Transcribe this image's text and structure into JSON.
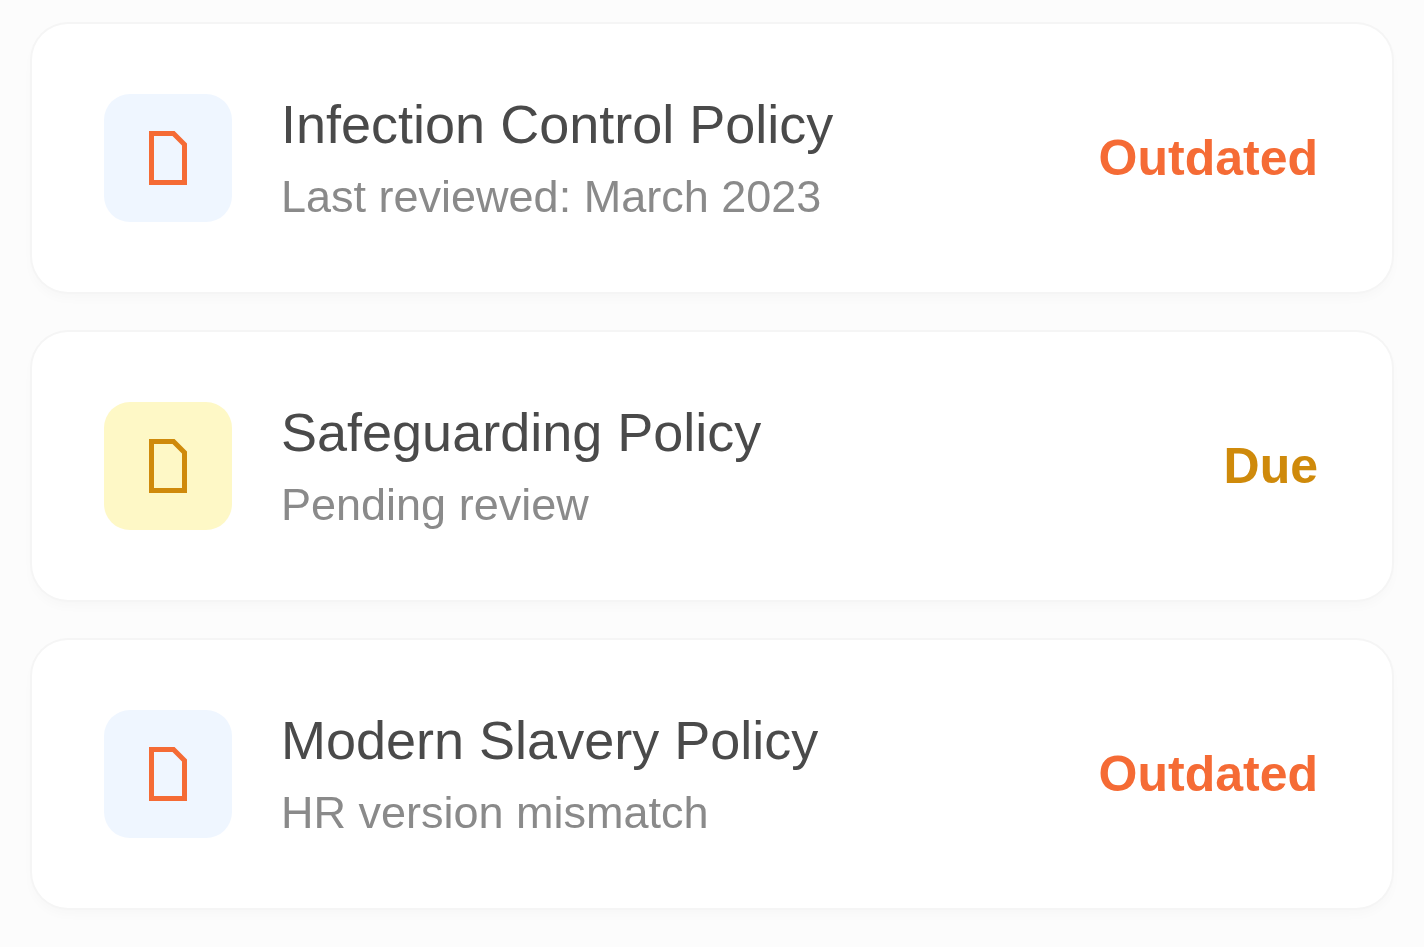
{
  "policies": [
    {
      "title": "Infection Control Policy",
      "detail": "Last reviewed: March 2023",
      "status": "Outdated",
      "kind": "outdated"
    },
    {
      "title": "Safeguarding Policy",
      "detail": "Pending review",
      "status": "Due",
      "kind": "due"
    },
    {
      "title": "Modern Slavery Policy",
      "detail": "HR version mismatch",
      "status": "Outdated",
      "kind": "outdated"
    }
  ]
}
